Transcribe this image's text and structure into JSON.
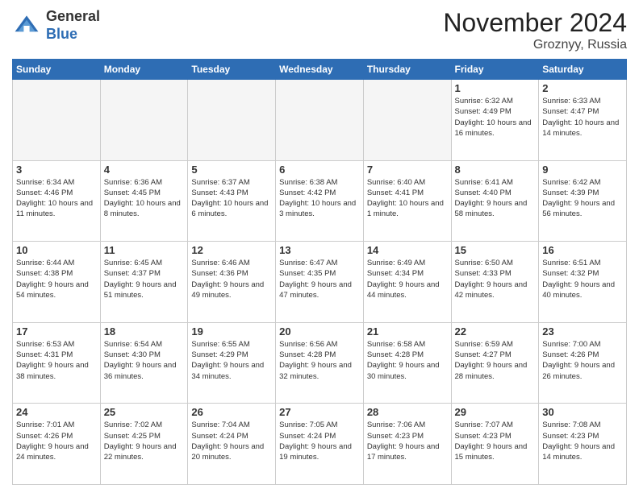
{
  "header": {
    "logo_general": "General",
    "logo_blue": "Blue",
    "month_title": "November 2024",
    "subtitle": "Groznyy, Russia"
  },
  "days_of_week": [
    "Sunday",
    "Monday",
    "Tuesday",
    "Wednesday",
    "Thursday",
    "Friday",
    "Saturday"
  ],
  "weeks": [
    [
      {
        "day": "",
        "info": ""
      },
      {
        "day": "",
        "info": ""
      },
      {
        "day": "",
        "info": ""
      },
      {
        "day": "",
        "info": ""
      },
      {
        "day": "",
        "info": ""
      },
      {
        "day": "1",
        "info": "Sunrise: 6:32 AM\nSunset: 4:49 PM\nDaylight: 10 hours and 16 minutes."
      },
      {
        "day": "2",
        "info": "Sunrise: 6:33 AM\nSunset: 4:47 PM\nDaylight: 10 hours and 14 minutes."
      }
    ],
    [
      {
        "day": "3",
        "info": "Sunrise: 6:34 AM\nSunset: 4:46 PM\nDaylight: 10 hours and 11 minutes."
      },
      {
        "day": "4",
        "info": "Sunrise: 6:36 AM\nSunset: 4:45 PM\nDaylight: 10 hours and 8 minutes."
      },
      {
        "day": "5",
        "info": "Sunrise: 6:37 AM\nSunset: 4:43 PM\nDaylight: 10 hours and 6 minutes."
      },
      {
        "day": "6",
        "info": "Sunrise: 6:38 AM\nSunset: 4:42 PM\nDaylight: 10 hours and 3 minutes."
      },
      {
        "day": "7",
        "info": "Sunrise: 6:40 AM\nSunset: 4:41 PM\nDaylight: 10 hours and 1 minute."
      },
      {
        "day": "8",
        "info": "Sunrise: 6:41 AM\nSunset: 4:40 PM\nDaylight: 9 hours and 58 minutes."
      },
      {
        "day": "9",
        "info": "Sunrise: 6:42 AM\nSunset: 4:39 PM\nDaylight: 9 hours and 56 minutes."
      }
    ],
    [
      {
        "day": "10",
        "info": "Sunrise: 6:44 AM\nSunset: 4:38 PM\nDaylight: 9 hours and 54 minutes."
      },
      {
        "day": "11",
        "info": "Sunrise: 6:45 AM\nSunset: 4:37 PM\nDaylight: 9 hours and 51 minutes."
      },
      {
        "day": "12",
        "info": "Sunrise: 6:46 AM\nSunset: 4:36 PM\nDaylight: 9 hours and 49 minutes."
      },
      {
        "day": "13",
        "info": "Sunrise: 6:47 AM\nSunset: 4:35 PM\nDaylight: 9 hours and 47 minutes."
      },
      {
        "day": "14",
        "info": "Sunrise: 6:49 AM\nSunset: 4:34 PM\nDaylight: 9 hours and 44 minutes."
      },
      {
        "day": "15",
        "info": "Sunrise: 6:50 AM\nSunset: 4:33 PM\nDaylight: 9 hours and 42 minutes."
      },
      {
        "day": "16",
        "info": "Sunrise: 6:51 AM\nSunset: 4:32 PM\nDaylight: 9 hours and 40 minutes."
      }
    ],
    [
      {
        "day": "17",
        "info": "Sunrise: 6:53 AM\nSunset: 4:31 PM\nDaylight: 9 hours and 38 minutes."
      },
      {
        "day": "18",
        "info": "Sunrise: 6:54 AM\nSunset: 4:30 PM\nDaylight: 9 hours and 36 minutes."
      },
      {
        "day": "19",
        "info": "Sunrise: 6:55 AM\nSunset: 4:29 PM\nDaylight: 9 hours and 34 minutes."
      },
      {
        "day": "20",
        "info": "Sunrise: 6:56 AM\nSunset: 4:28 PM\nDaylight: 9 hours and 32 minutes."
      },
      {
        "day": "21",
        "info": "Sunrise: 6:58 AM\nSunset: 4:28 PM\nDaylight: 9 hours and 30 minutes."
      },
      {
        "day": "22",
        "info": "Sunrise: 6:59 AM\nSunset: 4:27 PM\nDaylight: 9 hours and 28 minutes."
      },
      {
        "day": "23",
        "info": "Sunrise: 7:00 AM\nSunset: 4:26 PM\nDaylight: 9 hours and 26 minutes."
      }
    ],
    [
      {
        "day": "24",
        "info": "Sunrise: 7:01 AM\nSunset: 4:26 PM\nDaylight: 9 hours and 24 minutes."
      },
      {
        "day": "25",
        "info": "Sunrise: 7:02 AM\nSunset: 4:25 PM\nDaylight: 9 hours and 22 minutes."
      },
      {
        "day": "26",
        "info": "Sunrise: 7:04 AM\nSunset: 4:24 PM\nDaylight: 9 hours and 20 minutes."
      },
      {
        "day": "27",
        "info": "Sunrise: 7:05 AM\nSunset: 4:24 PM\nDaylight: 9 hours and 19 minutes."
      },
      {
        "day": "28",
        "info": "Sunrise: 7:06 AM\nSunset: 4:23 PM\nDaylight: 9 hours and 17 minutes."
      },
      {
        "day": "29",
        "info": "Sunrise: 7:07 AM\nSunset: 4:23 PM\nDaylight: 9 hours and 15 minutes."
      },
      {
        "day": "30",
        "info": "Sunrise: 7:08 AM\nSunset: 4:23 PM\nDaylight: 9 hours and 14 minutes."
      }
    ]
  ]
}
